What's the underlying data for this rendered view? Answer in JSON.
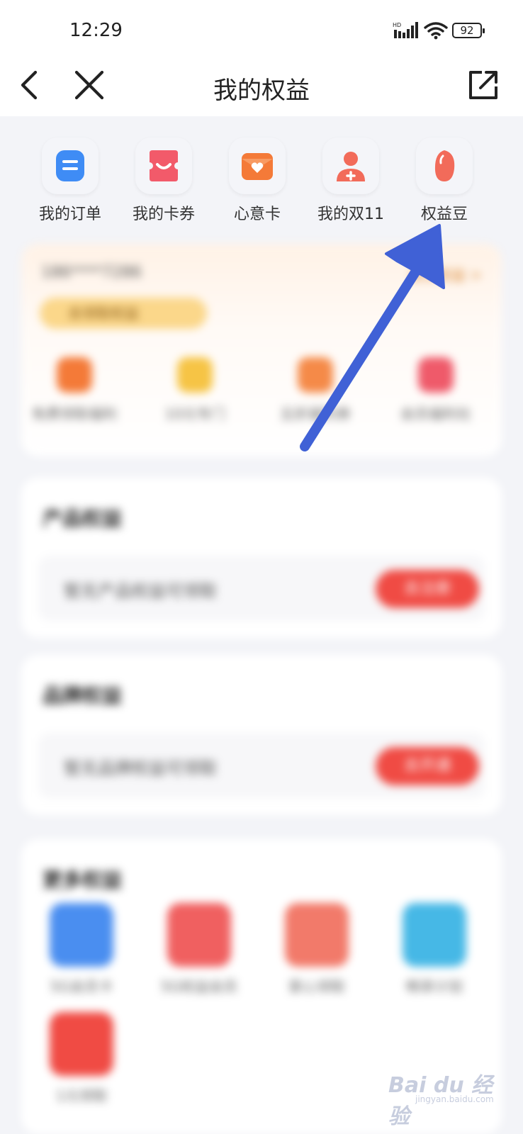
{
  "status": {
    "time": "12:29",
    "network": "HD",
    "battery": "92"
  },
  "nav": {
    "title": "我的权益"
  },
  "shortcuts": [
    {
      "label": "我的订单",
      "icon": "order-icon",
      "color": "#3f8cf5"
    },
    {
      "label": "我的卡券",
      "icon": "coupon-icon",
      "color": "#f25a6a"
    },
    {
      "label": "心意卡",
      "icon": "gift-card-icon",
      "color": "#f47a38"
    },
    {
      "label": "我的双11",
      "icon": "double11-icon",
      "color": "#f26b5a"
    },
    {
      "label": "权益豆",
      "icon": "bean-icon",
      "color": "#f26b5a"
    }
  ],
  "member": {
    "phone": "186****7286",
    "right_link": "会员权益 >",
    "pill": "去领取权益",
    "items": [
      {
        "label": "免费领取福利"
      },
      {
        "label": "10元专门"
      },
      {
        "label": "五折福利券"
      },
      {
        "label": "会员福利社"
      }
    ]
  },
  "sections": [
    {
      "title": "产品权益",
      "text": "暂无产品权益可领取",
      "button": "去注册"
    },
    {
      "title": "品牌权益",
      "text": "暂无品牌权益可领取",
      "button": "去开通"
    }
  ],
  "more": {
    "title": "更多权益",
    "items": [
      {
        "label": "5G会员卡"
      },
      {
        "label": "5G权益会员"
      },
      {
        "label": "爱心领取"
      },
      {
        "label": "畅享计划"
      },
      {
        "label": "1元领取"
      }
    ]
  },
  "watermark": {
    "text": "Bai du 经验",
    "sub": "jingyan.baidu.com"
  },
  "colors": {
    "accent": "#f04b44",
    "arrow": "#4061d6",
    "background": "#f3f4f8"
  }
}
